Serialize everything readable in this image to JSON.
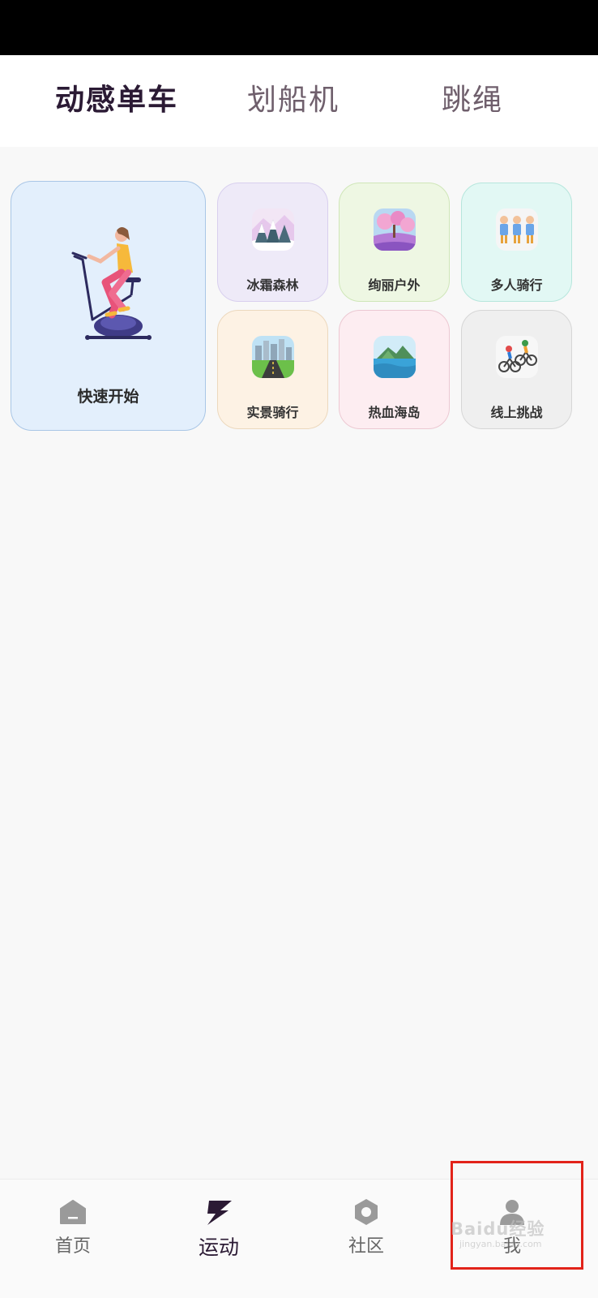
{
  "tabs": [
    {
      "label": "动感单车",
      "active": true
    },
    {
      "label": "划船机",
      "active": false
    },
    {
      "label": "跳绳",
      "active": false
    }
  ],
  "quick_start": {
    "label": "快速开始"
  },
  "cards": [
    {
      "label": "冰霜森林",
      "icon": "snowy-forest-icon"
    },
    {
      "label": "绚丽户外",
      "icon": "blossom-outdoor-icon"
    },
    {
      "label": "多人骑行",
      "icon": "group-riders-icon"
    },
    {
      "label": "实景骑行",
      "icon": "city-road-icon"
    },
    {
      "label": "热血海岛",
      "icon": "island-icon"
    },
    {
      "label": "线上挑战",
      "icon": "cyclists-icon"
    }
  ],
  "nav": [
    {
      "label": "首页",
      "icon": "home-icon",
      "active": false
    },
    {
      "label": "运动",
      "icon": "sport-icon",
      "active": true
    },
    {
      "label": "社区",
      "icon": "community-icon",
      "active": false
    },
    {
      "label": "我",
      "icon": "profile-icon",
      "active": false
    }
  ],
  "watermark": {
    "text": "Baidu经验",
    "sub": "jingyan.baidu.com"
  },
  "colors": {
    "accent": "#2b1a34",
    "highlight": "#e2231a"
  }
}
